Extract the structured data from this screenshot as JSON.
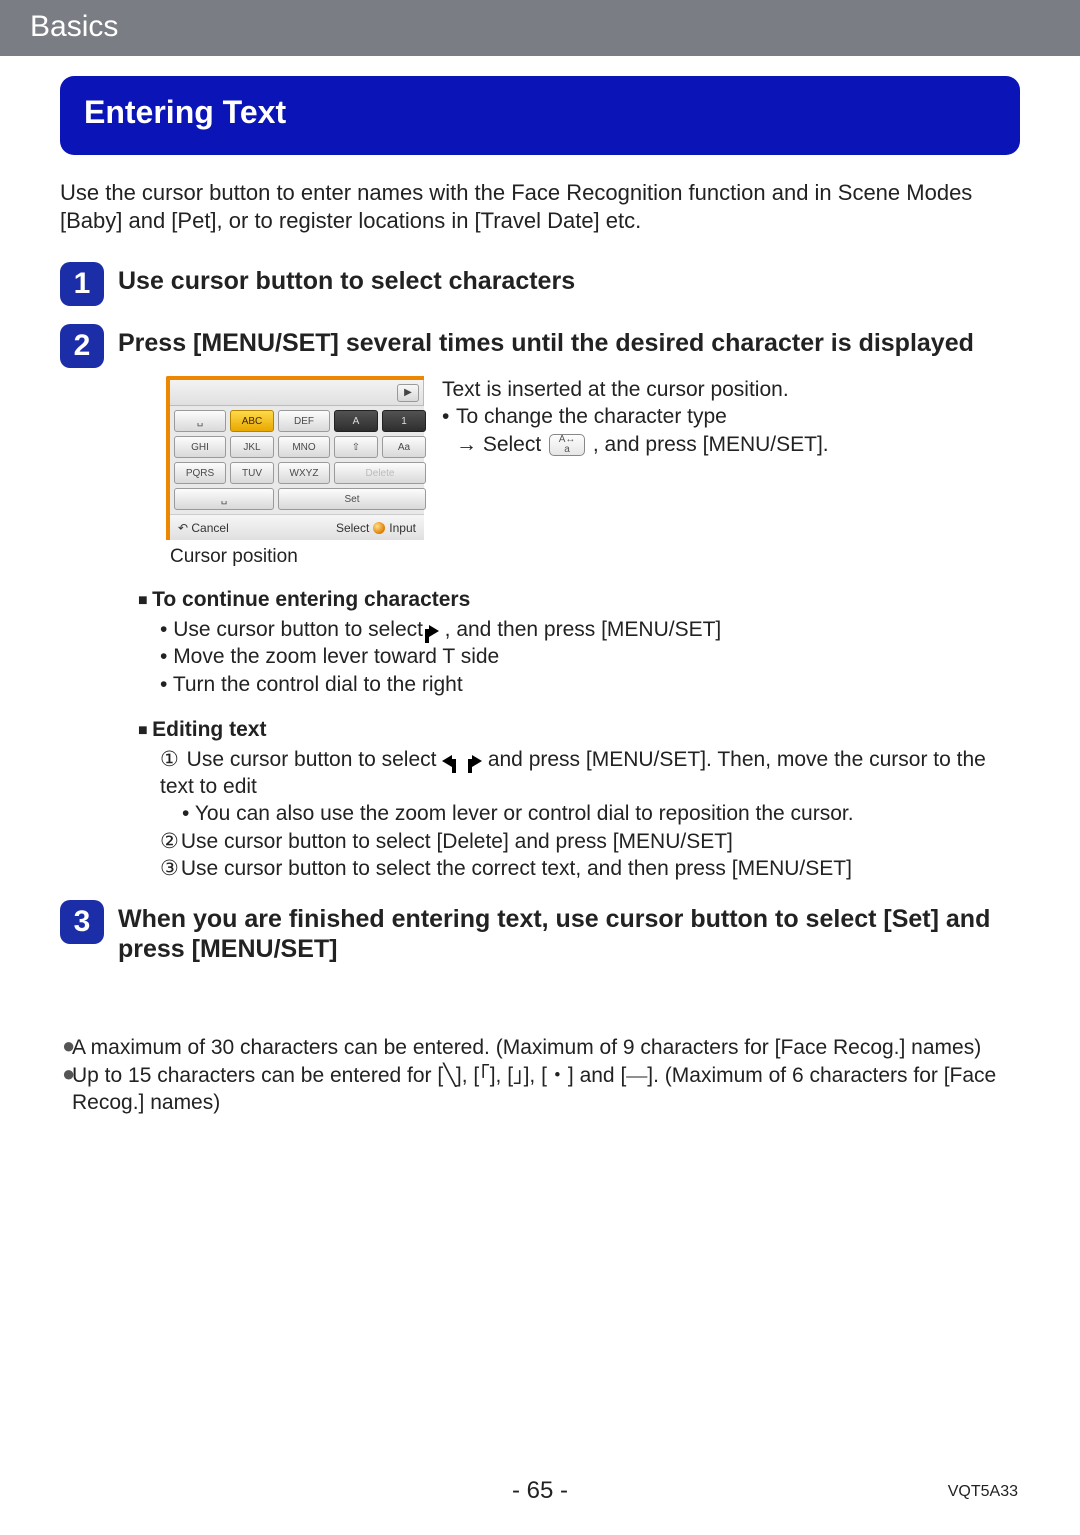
{
  "header": {
    "breadcrumb": "Basics"
  },
  "section_title": "Entering Text",
  "intro": "Use the cursor button to enter names with the Face Recognition function and in Scene Modes [Baby] and [Pet], or to register locations in [Travel Date] etc.",
  "steps": [
    {
      "num": "1",
      "title": "Use cursor button to select characters"
    },
    {
      "num": "2",
      "title": "Press [MENU/SET] several times until the desired character is displayed"
    },
    {
      "num": "3",
      "title": "When you are finished entering text, use cursor button to select [Set] and press [MENU/SET]"
    }
  ],
  "keyboard": {
    "caption": "Cursor position",
    "keys_row1": [
      "␣",
      "ABC",
      "DEF",
      "A",
      "1"
    ],
    "keys_row2": [
      "GHI",
      "JKL",
      "MNO",
      "⇧",
      "Aa"
    ],
    "keys_row3": [
      "PQRS",
      "TUV",
      "WXYZ",
      "Delete"
    ],
    "keys_row4": [
      "␣",
      "Set"
    ],
    "footer_left": "↶ Cancel",
    "footer_mid": "Select",
    "footer_right": "Input"
  },
  "insert_note": {
    "line1": "Text is inserted at the cursor position.",
    "bullet": "To change the character type",
    "arrow_line_pre": "→ Select ",
    "icon_top": "A↔",
    "icon_bot": "a",
    "arrow_line_post": ", and press [MENU/SET]."
  },
  "sub_continue": {
    "head": "To continue entering characters",
    "items": [
      {
        "pre": "Use cursor button to select ",
        "post": ", and then press [MENU/SET]",
        "icon": "right"
      },
      {
        "pre": "Move the zoom lever toward T side"
      },
      {
        "pre": "Turn the control dial to the right"
      }
    ]
  },
  "sub_edit": {
    "head": "Editing text",
    "c1_pre": "Use cursor button to select ",
    "c1_post": " and press [MENU/SET]. Then, move the cursor to the text to edit",
    "c1_note": "You can also use the zoom lever or control dial to reposition the cursor.",
    "c2": "Use cursor button to select [Delete] and press [MENU/SET]",
    "c3": "Use cursor button to select the correct text, and then press [MENU/SET]"
  },
  "notes": {
    "n1": "A maximum of 30 characters can be entered. (Maximum of 9 characters for [Face Recog.] names)",
    "n2_pre": "Up to 15 characters can be entered for [",
    "n2_s1": "╲",
    "n2_m1": "], [",
    "n2_s2": "「",
    "n2_m2": "], [",
    "n2_s3": "」",
    "n2_m3": "], [",
    "n2_s4": "・",
    "n2_m4": "] and [",
    "n2_s5": "―",
    "n2_post": "]. (Maximum of 6 characters for [Face Recog.] names)"
  },
  "footer": {
    "page": "- 65 -",
    "docid": "VQT5A33"
  }
}
